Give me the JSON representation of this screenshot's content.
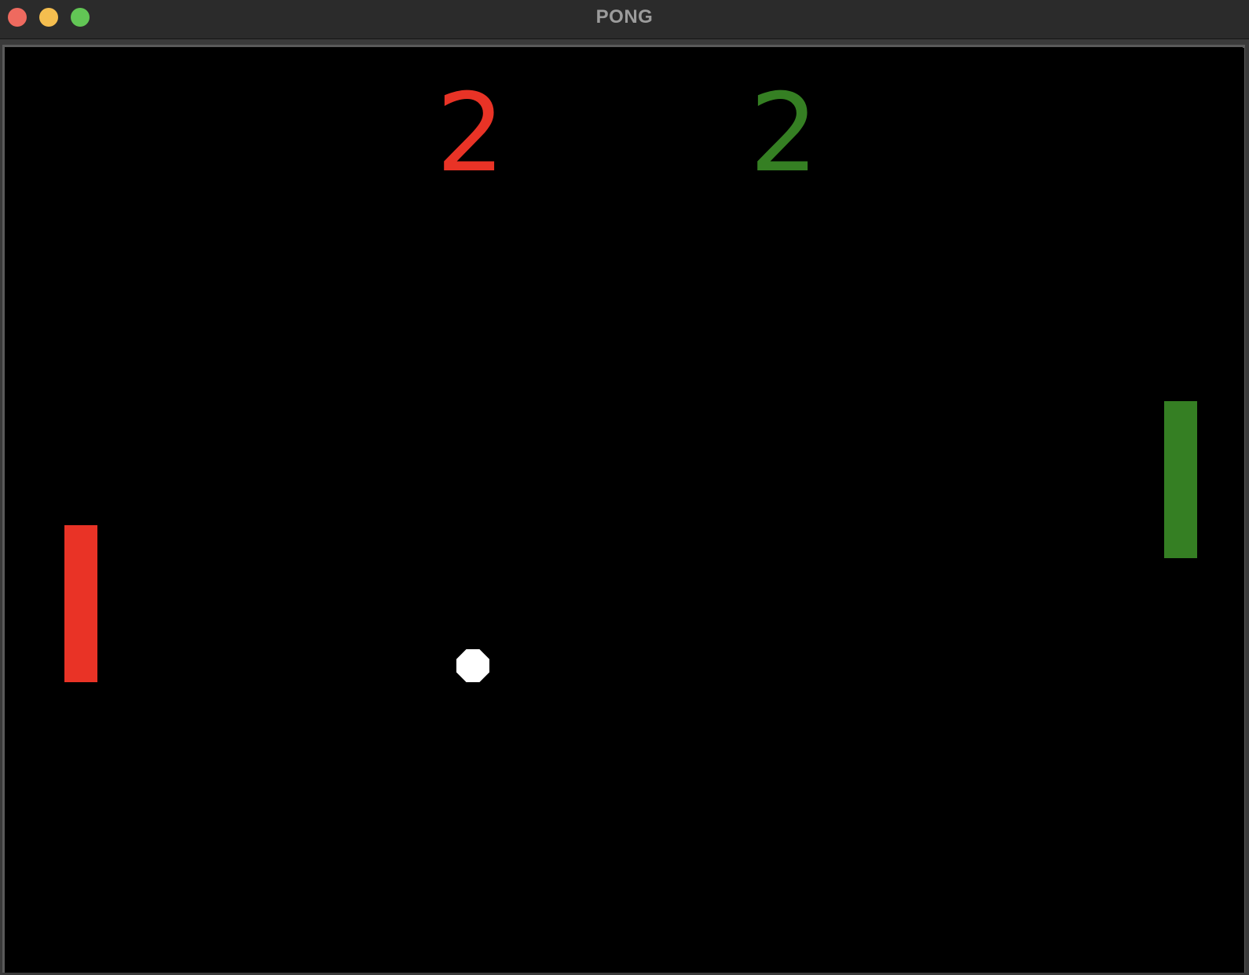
{
  "window": {
    "title": "PONG"
  },
  "scores": {
    "left": "2",
    "right": "2"
  },
  "colors": {
    "left_player": "#e93326",
    "right_player": "#357f23",
    "ball": "#ffffff",
    "background": "#000000"
  },
  "icons": {
    "close": "close-icon",
    "minimize": "minimize-icon",
    "zoom": "zoom-icon"
  }
}
